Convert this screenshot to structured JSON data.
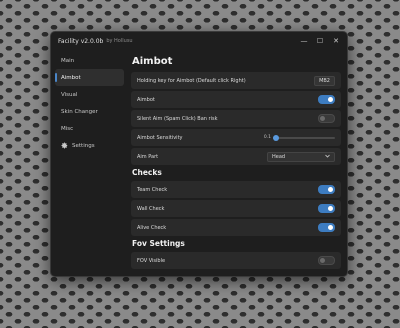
{
  "window": {
    "title": "Facility v2.0.0b",
    "subtitle": "by Hollusu",
    "controls": {
      "minimize": "—",
      "maximize": "☐",
      "close": "✕"
    }
  },
  "sidebar": {
    "items": [
      {
        "label": "Main"
      },
      {
        "label": "Aimbot"
      },
      {
        "label": "Visual"
      },
      {
        "label": "Skin Changer"
      },
      {
        "label": "Misc"
      },
      {
        "label": "Settings",
        "icon": "gear-icon"
      }
    ],
    "active": "Aimbot"
  },
  "aimbot": {
    "title": "Aimbot",
    "keybind_label": "Holding key for Aimbot (Default click Right)",
    "keybind_value": "MB2",
    "aimbot_label": "Aimbot",
    "aimbot_on": true,
    "silent_label": "Silent Aim (Spam Click) Ban risk",
    "silent_on": false,
    "sensitivity_label": "Aimbot Sensitivity",
    "sensitivity_value": "0.1",
    "sensitivity_fraction": 0.05,
    "aimpart_label": "Aim Part",
    "aimpart_value": "Head"
  },
  "checks": {
    "title": "Checks",
    "team_label": "Team Check",
    "team_on": true,
    "wall_label": "Wall Check",
    "wall_on": true,
    "alive_label": "Alive Check",
    "alive_on": true
  },
  "fov": {
    "title": "Fov Settings",
    "visible_label": "FOV Visible",
    "visible_on": false
  },
  "colors": {
    "accent": "#3d7cc0",
    "window_bg": "#1e1e1e",
    "row_bg": "#2a2a2a"
  }
}
